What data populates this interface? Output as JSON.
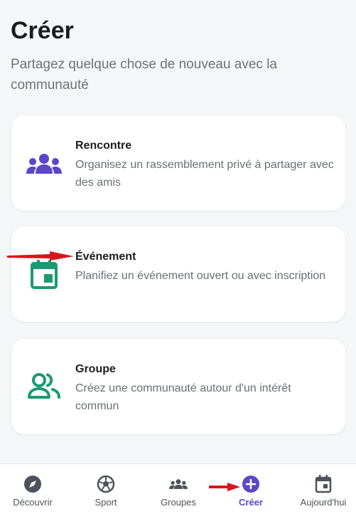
{
  "header": {
    "title": "Créer",
    "subtitle": "Partagez quelque chose de nouveau avec la communauté"
  },
  "cards": [
    {
      "title": "Rencontre",
      "description": "Organisez un rassemblement privé à partager avec des amis",
      "icon": "people-group-icon",
      "color": "#5a47c9"
    },
    {
      "title": "Événement",
      "description": "Planifiez un événement ouvert ou avec inscription",
      "icon": "calendar-event-icon",
      "color": "#1b9a72"
    },
    {
      "title": "Groupe",
      "description": "Créez une communauté autour d'un intérêt commun",
      "icon": "people-outline-icon",
      "color": "#1b9a72"
    }
  ],
  "nav": {
    "items": [
      {
        "label": "Découvrir",
        "icon": "compass-icon"
      },
      {
        "label": "Sport",
        "icon": "soccer-ball-icon"
      },
      {
        "label": "Groupes",
        "icon": "groups-icon"
      },
      {
        "label": "Créer",
        "icon": "plus-circle-icon",
        "active": true
      },
      {
        "label": "Aujourd'hui",
        "icon": "calendar-today-icon"
      }
    ]
  },
  "colors": {
    "accent": "#5a47c9",
    "green": "#1b9a72",
    "annotation_arrow": "#d9141b"
  }
}
